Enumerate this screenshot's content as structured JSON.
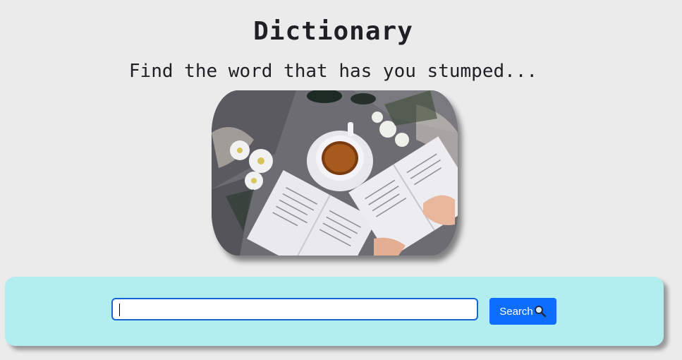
{
  "header": {
    "title": "Dictionary",
    "subtitle": "Find the word that has you stumped..."
  },
  "hero": {
    "icon": "books-and-tea-photo"
  },
  "search": {
    "value": "",
    "placeholder": "",
    "button_label": "Search",
    "button_icon": "magnifying-glass-icon"
  },
  "colors": {
    "background": "#ebebeb",
    "panel": "#b2eef0",
    "button": "#0d6efd",
    "input_border": "#1565d6"
  }
}
